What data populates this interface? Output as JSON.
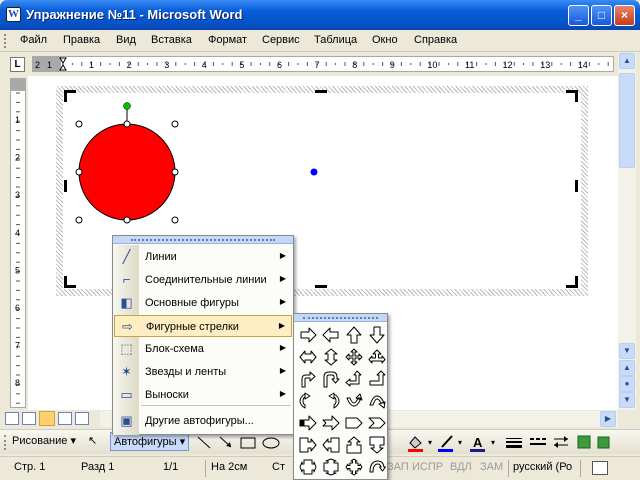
{
  "window": {
    "title": "Упражнение №11 - Microsoft Word",
    "app_icon": "W",
    "buttons": {
      "minimize": "_",
      "maximize": "□",
      "close": "×"
    }
  },
  "menubar": {
    "items": [
      "Файл",
      "Правка",
      "Вид",
      "Вставка",
      "Формат",
      "Сервис",
      "Таблица",
      "Окно",
      "Справка"
    ]
  },
  "ruler": {
    "tab_stop_button": "L",
    "h_numbers": [
      "1",
      "2",
      "1",
      "2",
      "3",
      "4",
      "5",
      "6",
      "7",
      "8",
      "9",
      "10",
      "11",
      "12",
      "13",
      "14"
    ],
    "v_numbers": [
      "1",
      "2",
      "3",
      "4",
      "5",
      "6",
      "7",
      "8"
    ]
  },
  "document": {
    "circle_fill": "#FF0000",
    "selection_handle_color": "#000000",
    "rotate_handle_color": "#00C000",
    "center_dot_color": "#0000FF"
  },
  "autoshapes_menu": {
    "items": [
      {
        "label": "Линии",
        "icon": "lines-icon",
        "submenu": true
      },
      {
        "label": "Соединительные линии",
        "icon": "connectors-icon",
        "submenu": true
      },
      {
        "label": "Основные фигуры",
        "icon": "basic-shapes-icon",
        "submenu": true
      },
      {
        "label": "Фигурные стрелки",
        "icon": "block-arrows-icon",
        "submenu": true,
        "highlighted": true
      },
      {
        "label": "Блок-схема",
        "icon": "flowchart-icon",
        "submenu": true
      },
      {
        "label": "Звезды и ленты",
        "icon": "stars-banners-icon",
        "submenu": true
      },
      {
        "label": "Выноски",
        "icon": "callouts-icon",
        "submenu": true
      },
      {
        "label": "Другие автофигуры...",
        "icon": "more-autoshapes-icon",
        "submenu": false
      }
    ]
  },
  "block_arrows_palette": {
    "shapes": [
      "right-arrow",
      "left-arrow",
      "up-arrow",
      "down-arrow",
      "left-right-arrow",
      "up-down-arrow",
      "quad-arrow",
      "left-right-up-arrow",
      "bent-arrow",
      "u-turn-arrow",
      "left-up-arrow",
      "bent-up-arrow",
      "curved-right-arrow",
      "curved-left-arrow",
      "curved-up-arrow",
      "curved-down-arrow",
      "striped-right-arrow",
      "notched-right-arrow",
      "pentagon",
      "chevron",
      "right-arrow-callout",
      "left-arrow-callout",
      "up-arrow-callout",
      "down-arrow-callout",
      "left-right-arrow-callout",
      "up-down-arrow-callout",
      "quad-arrow-callout",
      "circular-arrow"
    ]
  },
  "drawing_toolbar": {
    "draw_label": "Рисование",
    "autoshapes_label": "Автофигуры"
  },
  "statusbar": {
    "page": "Стр. 1",
    "section": "Разд 1",
    "pages": "1/1",
    "at": "На 2см",
    "line": "Ст",
    "rec": "ЗАП",
    "trk": "ИСПР",
    "ext": "ВДЛ",
    "ovr": "ЗАМ",
    "language": "русский (Ро"
  }
}
